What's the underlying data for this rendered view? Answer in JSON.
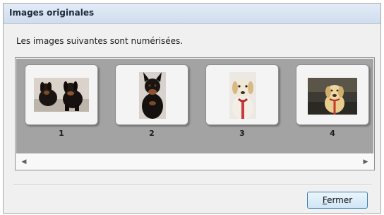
{
  "window": {
    "title": "Images originales",
    "message": "Les images suivantes sont numérisées."
  },
  "thumbnails": [
    {
      "number": "1",
      "icon": "two-black-dogs-photo"
    },
    {
      "number": "2",
      "icon": "black-dog-portrait-photo"
    },
    {
      "number": "3",
      "icon": "white-dog-portrait-photo"
    },
    {
      "number": "4",
      "icon": "yellow-dog-outdoor-photo"
    }
  ],
  "scrollbar": {
    "left_arrow": "◀",
    "right_arrow": "▶"
  },
  "buttons": {
    "close_label": "Fermer"
  },
  "colors": {
    "strip_background": "#a3a3a3",
    "titlebar": "#cfdcec",
    "button_border": "#3c7fb1"
  }
}
